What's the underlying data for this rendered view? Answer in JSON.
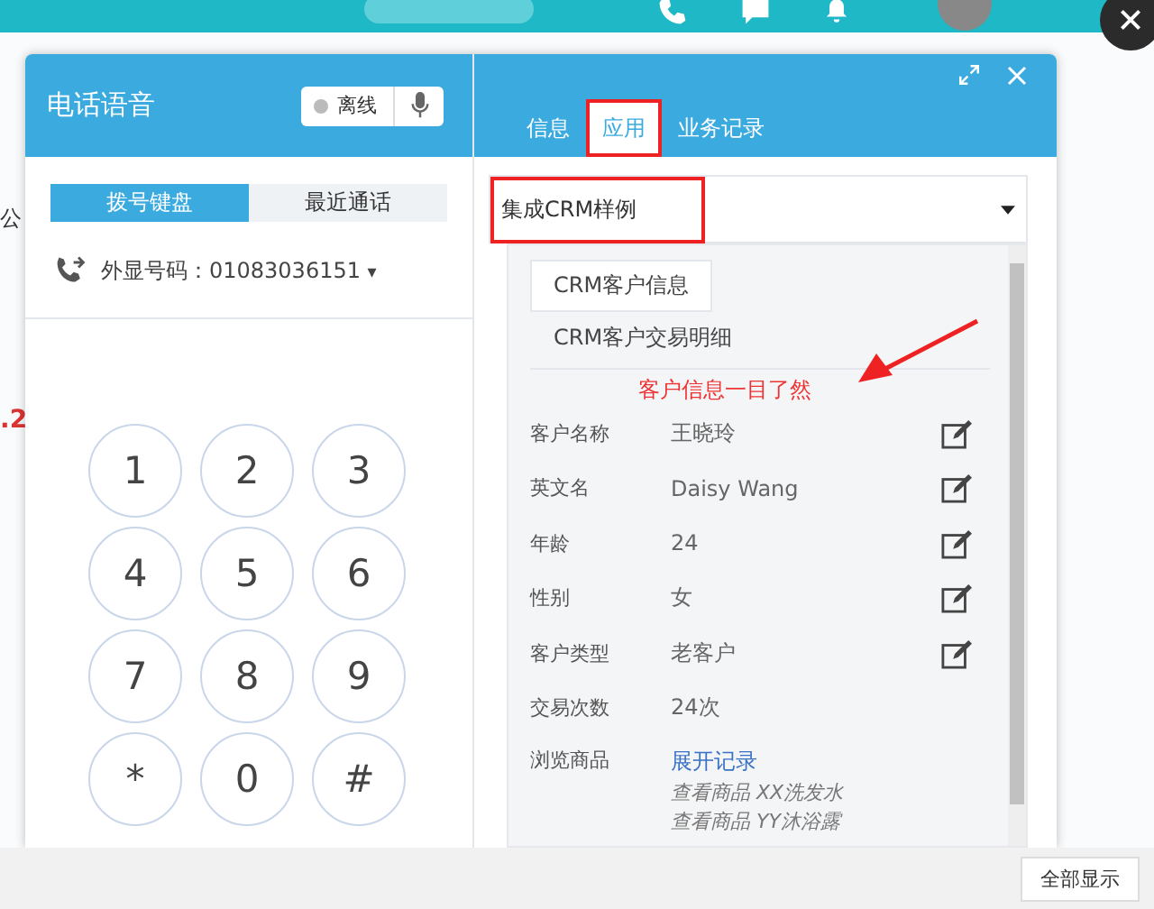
{
  "background_fragments": [
    {
      "text": "公",
      "kind": "plain"
    },
    {
      "text": ".2",
      "kind": "alert"
    }
  ],
  "window": {
    "title": "电话语音",
    "status": {
      "label": "离线",
      "online": false
    }
  },
  "left_tabs": [
    {
      "label": "拨号键盘",
      "selected": true
    },
    {
      "label": "最近通话",
      "selected": false
    }
  ],
  "caller_id": {
    "label": "外显号码：01083036151",
    "caret": "▾"
  },
  "keypad": [
    "1",
    "2",
    "3",
    "4",
    "5",
    "6",
    "7",
    "8",
    "9",
    "*",
    "0",
    "#"
  ],
  "right_tabs": [
    {
      "label": "信息",
      "selected": false,
      "highlighted": false
    },
    {
      "label": "应用",
      "selected": true,
      "highlighted": true
    },
    {
      "label": "业务记录",
      "selected": false,
      "highlighted": false
    }
  ],
  "app_select": {
    "value": "集成CRM样例",
    "highlighted": true
  },
  "crm_tabs": [
    {
      "label": "CRM客户信息",
      "selected": true
    },
    {
      "label": "CRM客户交易明细",
      "selected": false
    }
  ],
  "annotation": "客户信息一目了然",
  "fields": [
    {
      "label": "客户名称",
      "value": "王晓玲",
      "editable": true
    },
    {
      "label": "英文名",
      "value": "Daisy Wang",
      "editable": true
    },
    {
      "label": "年龄",
      "value": "24",
      "editable": true
    },
    {
      "label": "性别",
      "value": "女",
      "editable": true
    },
    {
      "label": "客户类型",
      "value": "老客户",
      "editable": true
    },
    {
      "label": "交易次数",
      "value": "24次",
      "editable": false
    }
  ],
  "browsing": {
    "label": "浏览商品",
    "link": "展开记录",
    "items": [
      "查看商品 XX洗发水",
      "查看商品 YY沐浴露"
    ]
  },
  "footer": {
    "button": "全部显示"
  }
}
